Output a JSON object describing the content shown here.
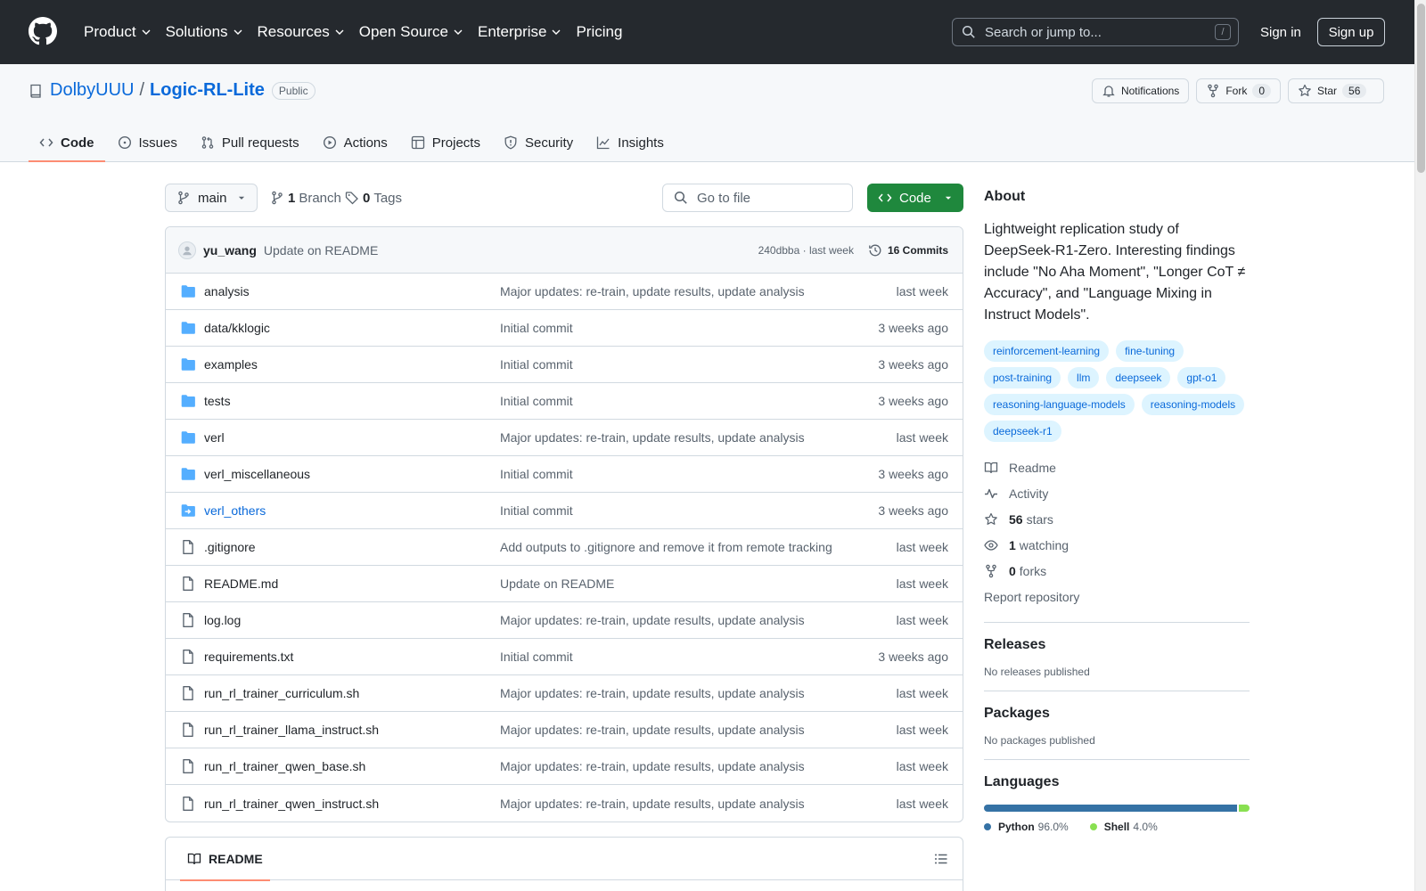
{
  "header": {
    "nav": [
      {
        "label": "Product",
        "has_menu": true
      },
      {
        "label": "Solutions",
        "has_menu": true
      },
      {
        "label": "Resources",
        "has_menu": true
      },
      {
        "label": "Open Source",
        "has_menu": true
      },
      {
        "label": "Enterprise",
        "has_menu": true
      },
      {
        "label": "Pricing",
        "has_menu": false
      }
    ],
    "search_placeholder": "Search or jump to...",
    "search_shortcut": "/",
    "sign_in": "Sign in",
    "sign_up": "Sign up"
  },
  "repo": {
    "owner": "DolbyUUU",
    "separator": "/",
    "name": "Logic-RL-Lite",
    "visibility": "Public",
    "notifications_label": "Notifications",
    "fork_label": "Fork",
    "fork_count": "0",
    "star_label": "Star",
    "star_count": "56"
  },
  "tabs": [
    {
      "label": "Code",
      "icon": "code-icon",
      "active": true
    },
    {
      "label": "Issues",
      "icon": "issue-icon",
      "active": false
    },
    {
      "label": "Pull requests",
      "icon": "pull-request-icon",
      "active": false
    },
    {
      "label": "Actions",
      "icon": "play-icon",
      "active": false
    },
    {
      "label": "Projects",
      "icon": "table-icon",
      "active": false
    },
    {
      "label": "Security",
      "icon": "shield-icon",
      "active": false
    },
    {
      "label": "Insights",
      "icon": "graph-icon",
      "active": false
    }
  ],
  "branch": {
    "current": "main",
    "branch_count": "1",
    "branch_label": "Branch",
    "tag_count": "0",
    "tag_label": "Tags",
    "goto_placeholder": "Go to file",
    "code_button": "Code"
  },
  "latest_commit": {
    "author": "yu_wang",
    "message": "Update on README",
    "meta": "240dbba · last week",
    "history_label": "16 Commits"
  },
  "files": [
    {
      "name": "analysis",
      "type": "folder",
      "message": "Major updates: re-train, update results, update analysis",
      "time": "last week"
    },
    {
      "name": "data/kklogic",
      "type": "folder",
      "message": "Initial commit",
      "time": "3 weeks ago"
    },
    {
      "name": "examples",
      "type": "folder",
      "message": "Initial commit",
      "time": "3 weeks ago"
    },
    {
      "name": "tests",
      "type": "folder",
      "message": "Initial commit",
      "time": "3 weeks ago"
    },
    {
      "name": "verl",
      "type": "folder",
      "message": "Major updates: re-train, update results, update analysis",
      "time": "last week"
    },
    {
      "name": "verl_miscellaneous",
      "type": "folder",
      "message": "Initial commit",
      "time": "3 weeks ago"
    },
    {
      "name": "verl_others",
      "type": "submodule",
      "message": "Initial commit",
      "time": "3 weeks ago"
    },
    {
      "name": ".gitignore",
      "type": "file",
      "message": "Add outputs to .gitignore and remove it from remote tracking",
      "time": "last week"
    },
    {
      "name": "README.md",
      "type": "file",
      "message": "Update on README",
      "time": "last week"
    },
    {
      "name": "log.log",
      "type": "file",
      "message": "Major updates: re-train, update results, update analysis",
      "time": "last week"
    },
    {
      "name": "requirements.txt",
      "type": "file",
      "message": "Initial commit",
      "time": "3 weeks ago"
    },
    {
      "name": "run_rl_trainer_curriculum.sh",
      "type": "file",
      "message": "Major updates: re-train, update results, update analysis",
      "time": "last week"
    },
    {
      "name": "run_rl_trainer_llama_instruct.sh",
      "type": "file",
      "message": "Major updates: re-train, update results, update analysis",
      "time": "last week"
    },
    {
      "name": "run_rl_trainer_qwen_base.sh",
      "type": "file",
      "message": "Major updates: re-train, update results, update analysis",
      "time": "last week"
    },
    {
      "name": "run_rl_trainer_qwen_instruct.sh",
      "type": "file",
      "message": "Major updates: re-train, update results, update analysis",
      "time": "last week"
    }
  ],
  "readme": {
    "tab_label": "README"
  },
  "about": {
    "heading": "About",
    "description": "Lightweight replication study of DeepSeek-R1-Zero. Interesting findings include \"No Aha Moment\", \"Longer CoT ≠ Accuracy\", and \"Language Mixing in Instruct Models\".",
    "topics": [
      "reinforcement-learning",
      "fine-tuning",
      "post-training",
      "llm",
      "deepseek",
      "gpt-o1",
      "reasoning-language-models",
      "reasoning-models",
      "deepseek-r1"
    ],
    "links": [
      {
        "icon": "book-icon",
        "count": "",
        "label": "Readme"
      },
      {
        "icon": "pulse-icon",
        "count": "",
        "label": "Activity"
      },
      {
        "icon": "star-icon",
        "count": "56",
        "label": "stars"
      },
      {
        "icon": "eye-icon",
        "count": "1",
        "label": "watching"
      },
      {
        "icon": "fork-icon",
        "count": "0",
        "label": "forks"
      }
    ],
    "report": "Report repository"
  },
  "releases": {
    "heading": "Releases",
    "empty": "No releases published"
  },
  "packages": {
    "heading": "Packages",
    "empty": "No packages published"
  },
  "languages": {
    "heading": "Languages",
    "items": [
      {
        "name": "Python",
        "percent": "96.0%",
        "value": 96.0,
        "color": "#3572A5"
      },
      {
        "name": "Shell",
        "percent": "4.0%",
        "value": 4.0,
        "color": "#89e051"
      }
    ]
  },
  "colors": {
    "header_bg": "#25292e",
    "link": "#0969da",
    "primary_button": "#1f883d",
    "active_tab_underline": "#fd8c73",
    "folder": "#54aeff"
  }
}
